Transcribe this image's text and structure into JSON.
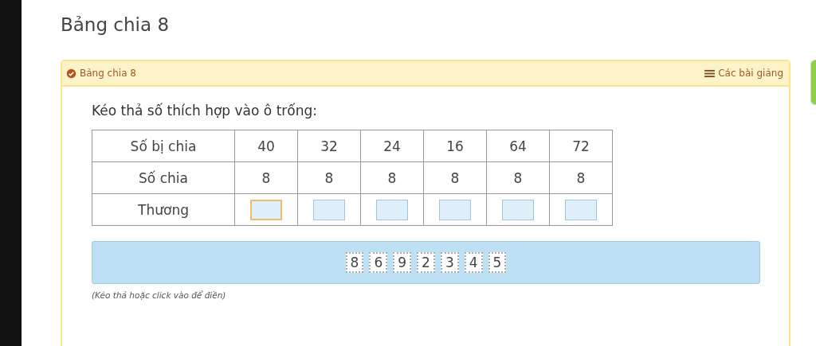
{
  "page_title": "Bảng chia 8",
  "panel": {
    "title": "Bảng chia 8",
    "lessons_link": "Các bài giảng"
  },
  "instruction": "Kéo thả số thích hợp vào ô trống:",
  "table": {
    "rows": [
      {
        "header": "Số bị chia",
        "cells": [
          "40",
          "32",
          "24",
          "16",
          "64",
          "72"
        ]
      },
      {
        "header": "Số chia",
        "cells": [
          "8",
          "8",
          "8",
          "8",
          "8",
          "8"
        ]
      }
    ],
    "answer_row": {
      "header": "Thương",
      "slots": [
        {
          "selected": true
        },
        {
          "selected": false
        },
        {
          "selected": false
        },
        {
          "selected": false
        },
        {
          "selected": false
        },
        {
          "selected": false
        }
      ]
    }
  },
  "tiles": [
    "8",
    "6",
    "9",
    "2",
    "3",
    "4",
    "5"
  ],
  "hint": "(Kéo thả hoặc click vào để điền)"
}
